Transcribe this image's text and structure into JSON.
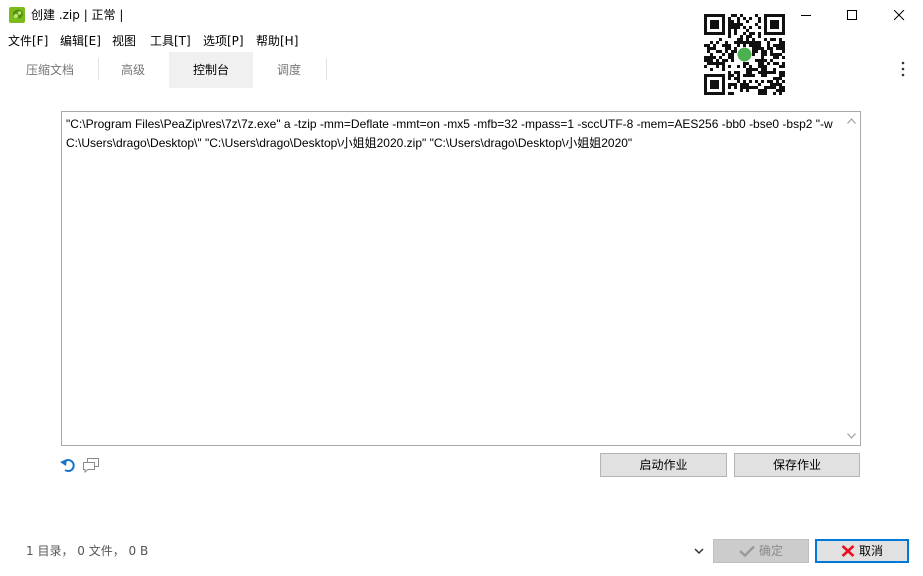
{
  "window": {
    "title": "创建 .zip | 正常 |",
    "app_icon": "peazip-icon"
  },
  "menu": {
    "items": [
      {
        "label": "文件[F]"
      },
      {
        "label": "编辑[E]"
      },
      {
        "label": "视图"
      },
      {
        "label": "工具[T]"
      },
      {
        "label": "选项[P]"
      },
      {
        "label": "帮助[H]"
      }
    ]
  },
  "tabs": [
    {
      "label": "压缩文档",
      "active": false
    },
    {
      "label": "高级",
      "active": false
    },
    {
      "label": "控制台",
      "active": true
    },
    {
      "label": "调度",
      "active": false
    }
  ],
  "console": {
    "command": "\"C:\\Program Files\\PeaZip\\res\\7z\\7z.exe\" a -tzip -mm=Deflate -mmt=on -mx5 -mfb=32 -mpass=1 -sccUTF-8 -mem=AES256 -bb0 -bse0 -bsp2 \"-wC:\\Users\\drago\\Desktop\\\" \"C:\\Users\\drago\\Desktop\\小姐姐2020.zip\" \"C:\\Users\\drago\\Desktop\\小姐姐2020\""
  },
  "actions": {
    "start_job_label": "启动作业",
    "save_job_label": "保存作业"
  },
  "status": {
    "summary": "1 目录， 0 文件， 0 B"
  },
  "footer": {
    "ok_label": "确定",
    "cancel_label": "取消"
  },
  "colors": {
    "accent": "#0078d7",
    "active_tab_bg": "#f0f0f0",
    "cancel_icon": "#e81123",
    "button_bg": "#e1e1e1"
  }
}
